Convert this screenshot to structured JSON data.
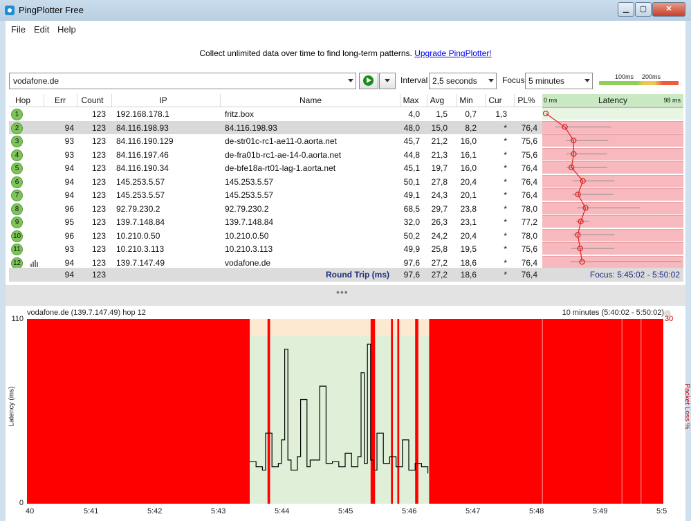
{
  "window": {
    "title": "PingPlotter Free"
  },
  "menu": [
    "File",
    "Edit",
    "Help"
  ],
  "promo": {
    "text": "Collect unlimited data over time to find long-term patterns. ",
    "link": "Upgrade PingPlotter!"
  },
  "toolbar": {
    "target": "vodafone.de",
    "interval_label": "Interval",
    "interval_value": "2,5 seconds",
    "focus_label": "Focus",
    "focus_value": "5 minutes",
    "legend_100": "100ms",
    "legend_200": "200ms"
  },
  "grid": {
    "headers": [
      "Hop",
      "Err",
      "Count",
      "IP",
      "Name",
      "Max",
      "Avg",
      "Min",
      "Cur",
      "PL%"
    ],
    "latency_header": "Latency",
    "latency_min": "0 ms",
    "latency_max": "98 ms",
    "rows": [
      {
        "hop": "1",
        "err": "",
        "count": "123",
        "ip": "192.168.178.1",
        "name": "fritz.box",
        "max": "4,0",
        "avg": "1,5",
        "min": "0,7",
        "cur": "1,3",
        "pl": ""
      },
      {
        "hop": "2",
        "err": "94",
        "count": "123",
        "ip": "84.116.198.93",
        "name": "84.116.198.93",
        "max": "48,0",
        "avg": "15,0",
        "min": "8,2",
        "cur": "*",
        "pl": "76,4"
      },
      {
        "hop": "3",
        "err": "93",
        "count": "123",
        "ip": "84.116.190.129",
        "name": "de-str01c-rc1-ae11-0.aorta.net",
        "max": "45,7",
        "avg": "21,2",
        "min": "16,0",
        "cur": "*",
        "pl": "75,6"
      },
      {
        "hop": "4",
        "err": "93",
        "count": "123",
        "ip": "84.116.197.46",
        "name": "de-fra01b-rc1-ae-14-0.aorta.net",
        "max": "44,8",
        "avg": "21,3",
        "min": "16,1",
        "cur": "*",
        "pl": "75,6"
      },
      {
        "hop": "5",
        "err": "94",
        "count": "123",
        "ip": "84.116.190.34",
        "name": "de-bfe18a-rt01-lag-1.aorta.net",
        "max": "45,1",
        "avg": "19,7",
        "min": "16,0",
        "cur": "*",
        "pl": "76,4"
      },
      {
        "hop": "6",
        "err": "94",
        "count": "123",
        "ip": "145.253.5.57",
        "name": "145.253.5.57",
        "max": "50,1",
        "avg": "27,8",
        "min": "20,4",
        "cur": "*",
        "pl": "76,4"
      },
      {
        "hop": "7",
        "err": "94",
        "count": "123",
        "ip": "145.253.5.57",
        "name": "145.253.5.57",
        "max": "49,1",
        "avg": "24,3",
        "min": "20,1",
        "cur": "*",
        "pl": "76,4"
      },
      {
        "hop": "8",
        "err": "96",
        "count": "123",
        "ip": "92.79.230.2",
        "name": "92.79.230.2",
        "max": "68,5",
        "avg": "29,7",
        "min": "23,8",
        "cur": "*",
        "pl": "78,0"
      },
      {
        "hop": "9",
        "err": "95",
        "count": "123",
        "ip": "139.7.148.84",
        "name": "139.7.148.84",
        "max": "32,0",
        "avg": "26,3",
        "min": "23,1",
        "cur": "*",
        "pl": "77,2"
      },
      {
        "hop": "10",
        "err": "96",
        "count": "123",
        "ip": "10.210.0.50",
        "name": "10.210.0.50",
        "max": "50,2",
        "avg": "24,2",
        "min": "20,4",
        "cur": "*",
        "pl": "78,0"
      },
      {
        "hop": "11",
        "err": "93",
        "count": "123",
        "ip": "10.210.3.113",
        "name": "10.210.3.113",
        "max": "49,9",
        "avg": "25,8",
        "min": "19,5",
        "cur": "*",
        "pl": "75,6"
      },
      {
        "hop": "12",
        "err": "94",
        "count": "123",
        "ip": "139.7.147.49",
        "name": "vodafone.de",
        "max": "97,6",
        "avg": "27,2",
        "min": "18,6",
        "cur": "*",
        "pl": "76,4"
      }
    ],
    "totals": {
      "err": "94",
      "count": "123",
      "label": "Round Trip (ms)",
      "max": "97,6",
      "avg": "27,2",
      "min": "18,6",
      "cur": "*",
      "pl": "76,4",
      "focus": "Focus: 5:45:02 - 5:50:02"
    }
  },
  "graph": {
    "title": "vodafone.de (139.7.147.49) hop 12",
    "range": "10 minutes (5:40:02 - 5:50:02)",
    "y_axis_label": "Latency (ms)",
    "y2_axis_label": "Packet Loss %",
    "y_ticks": [
      "110",
      "0"
    ],
    "y2_ticks": [
      "30"
    ],
    "x_ticks": [
      "40",
      "5:41",
      "5:42",
      "5:43",
      "5:44",
      "5:45",
      "5:46",
      "5:47",
      "5:48",
      "5:49",
      "5:5"
    ]
  },
  "colors": {
    "loss": "#fe0000",
    "good": "#dfefd8",
    "pale": "#fde9d2",
    "row_red": "#f7b9bd",
    "line": "#000000"
  },
  "chart_data": {
    "type": "line",
    "title": "vodafone.de (139.7.147.49) hop 12",
    "xlabel": "",
    "ylabel": "Latency (ms)",
    "ylim": [
      0,
      110
    ],
    "x_range_minutes": [
      0,
      10
    ],
    "series": [
      {
        "name": "",
        "t": [
          3.5,
          3.6,
          3.7,
          3.75,
          3.85,
          3.95,
          4.0,
          4.05,
          4.1,
          4.15,
          4.25,
          4.3,
          4.4,
          4.45,
          4.6,
          4.7,
          4.8,
          4.9,
          5.0,
          5.1,
          5.2,
          5.25,
          5.3,
          5.35,
          5.4,
          5.45,
          5.5,
          5.6,
          5.7,
          5.8,
          5.9,
          6.0,
          6.1,
          6.2,
          6.3
        ],
        "values": [
          25,
          22,
          20,
          42,
          22,
          24,
          38,
          92,
          26,
          20,
          28,
          62,
          22,
          26,
          70,
          24,
          25,
          22,
          30,
          22,
          28,
          78,
          24,
          95,
          26,
          20,
          42,
          24,
          28,
          22,
          38,
          20,
          24,
          22,
          18
        ]
      }
    ],
    "loss_bands": [
      [
        0,
        3.5
      ],
      [
        3.78,
        3.82
      ],
      [
        5.4,
        5.47
      ],
      [
        5.72,
        5.75
      ],
      [
        5.82,
        5.85
      ],
      [
        6.1,
        6.15
      ],
      [
        6.32,
        10
      ]
    ]
  }
}
